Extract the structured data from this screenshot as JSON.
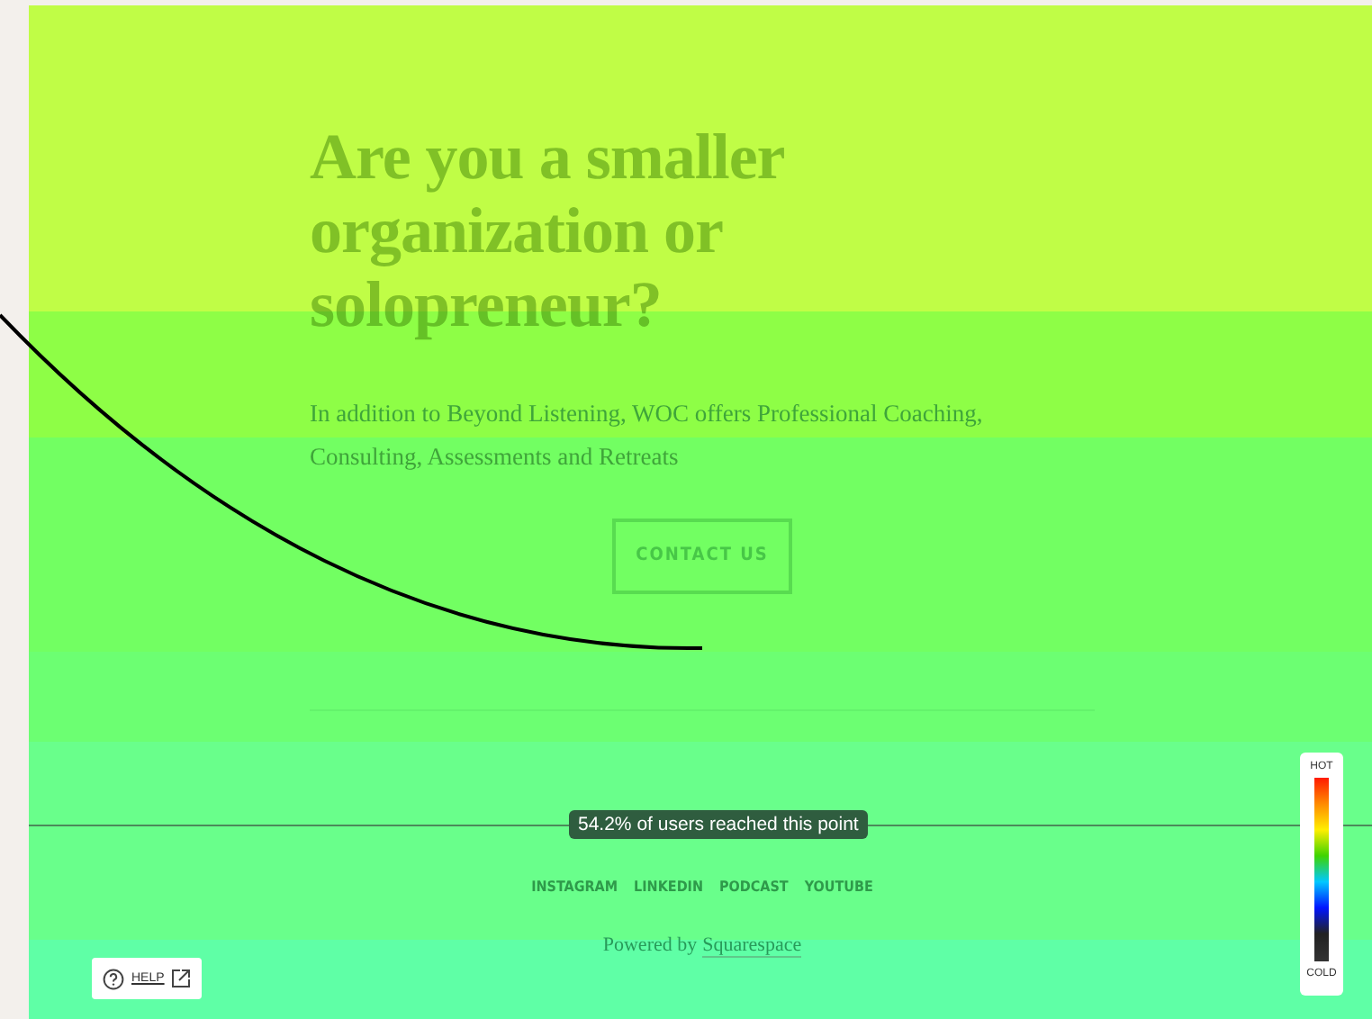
{
  "page": {
    "heading": "Are you a smaller organization or solopreneur?",
    "body": "In addition to Beyond Listening, WOC offers Professional Coaching, Consulting, Assessments and Retreats",
    "button": "CONTACT US",
    "social_links": [
      "INSTAGRAM",
      "LINKEDIN",
      "PODCAST",
      "YOUTUBE"
    ],
    "powered_by": "Powered by",
    "powered_by_link": "Squarespace"
  },
  "scroll_marker": {
    "label": "54.2% of users reached this point"
  },
  "legend": {
    "hot": "HOT",
    "cold": "COLD"
  },
  "help": {
    "label": "HELP"
  }
}
